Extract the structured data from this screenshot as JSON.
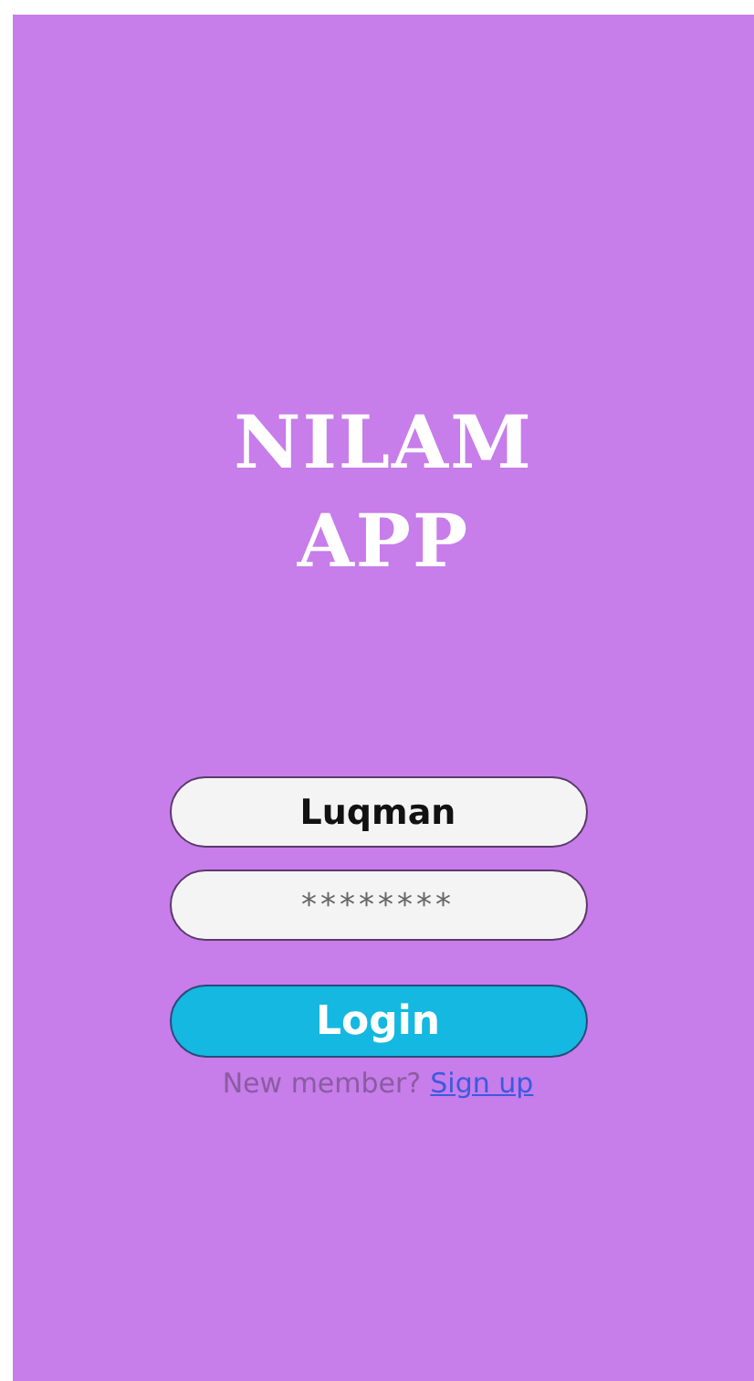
{
  "title": [
    "NILAM",
    "APP"
  ],
  "username": {
    "value": "Luqman"
  },
  "password": {
    "value": "********"
  },
  "login_button": "Login",
  "signup_prompt": {
    "text": "New member?",
    "link": "Sign up"
  }
}
